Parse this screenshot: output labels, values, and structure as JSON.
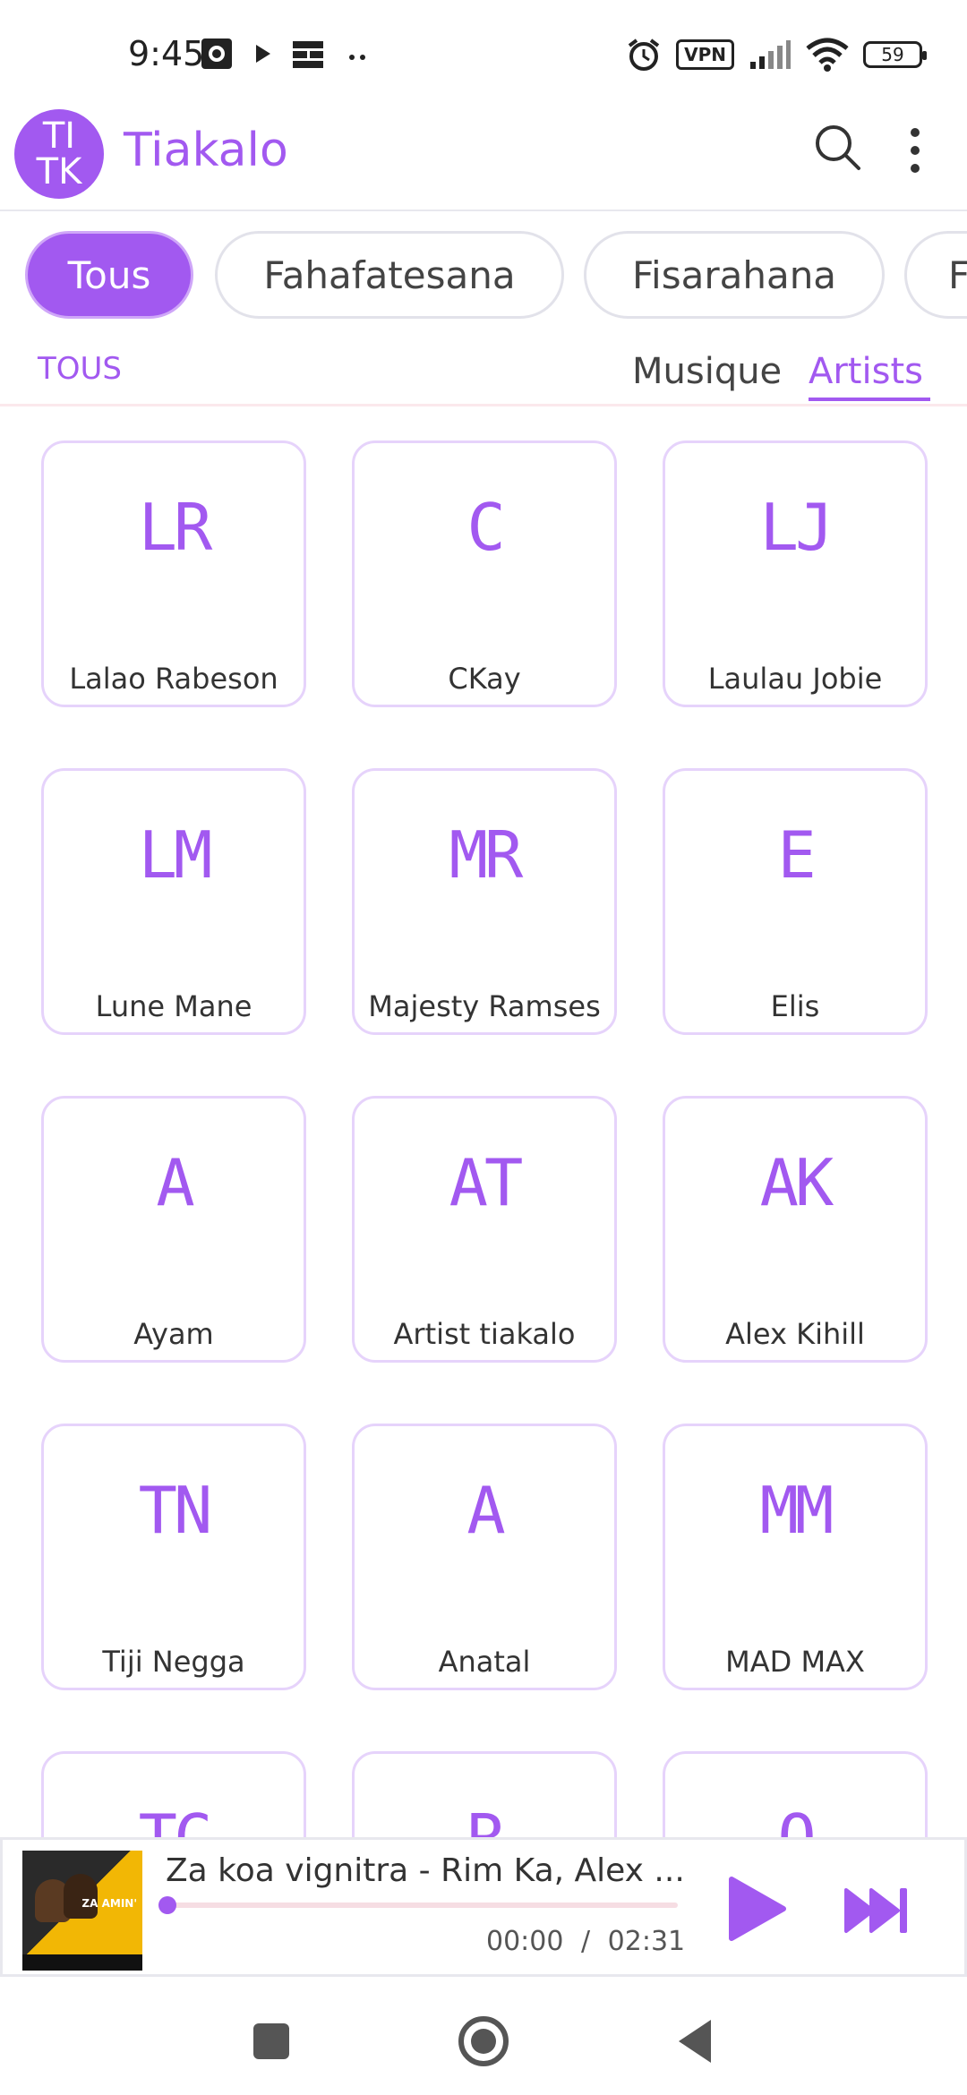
{
  "status_bar": {
    "time": "9:45",
    "vpn": "VPN",
    "battery": "59",
    "icons": [
      "screenshot-icon",
      "play-store-icon",
      "grid-app-icon",
      "more-dots-icon",
      "alarm-icon",
      "vpn-icon",
      "signal-icon",
      "wifi-icon",
      "battery-icon"
    ]
  },
  "app_bar": {
    "logo_top": "TI",
    "logo_bottom": "TK",
    "title": "Tiakalo",
    "icons": [
      "search-icon",
      "more-vertical-icon"
    ]
  },
  "chips": [
    "Tous",
    "Fahafatesana",
    "Fisarahana",
    "F"
  ],
  "filter": {
    "label": "TOUS",
    "tabs": [
      "Musique",
      "Artists"
    ],
    "active_tab": "Artists"
  },
  "artists": [
    {
      "initials": "LR",
      "name": "Lalao Rabeson"
    },
    {
      "initials": "C",
      "name": "CKay"
    },
    {
      "initials": "LJ",
      "name": "Laulau Jobie"
    },
    {
      "initials": "LM",
      "name": "Lune Mane"
    },
    {
      "initials": "MR",
      "name": "Majesty Ramses"
    },
    {
      "initials": "E",
      "name": "Elis"
    },
    {
      "initials": "A",
      "name": "Ayam"
    },
    {
      "initials": "AT",
      "name": "Artist tiakalo"
    },
    {
      "initials": "AK",
      "name": "Alex Kihill"
    },
    {
      "initials": "TN",
      "name": "Tiji Negga"
    },
    {
      "initials": "A",
      "name": "Anatal"
    },
    {
      "initials": "MM",
      "name": "MAD MAX"
    },
    {
      "initials": "TC",
      "name": ""
    },
    {
      "initials": "R",
      "name": ""
    },
    {
      "initials": "O",
      "name": ""
    }
  ],
  "player": {
    "album_text": "ZA AMIN'",
    "track": "Za koa vignitra - Rim Ka, Alex ...",
    "current_time": "00:00",
    "separator": "/",
    "duration": "02:31",
    "progress": 0,
    "icons": [
      "play-icon",
      "skip-next-icon"
    ]
  },
  "nav": {
    "icons": [
      "recents-square-icon",
      "home-circle-icon",
      "back-triangle-icon"
    ]
  },
  "colors": {
    "accent": "#a259f0",
    "card_border": "#e6d3fb",
    "progress_track": "#f6dde3"
  }
}
